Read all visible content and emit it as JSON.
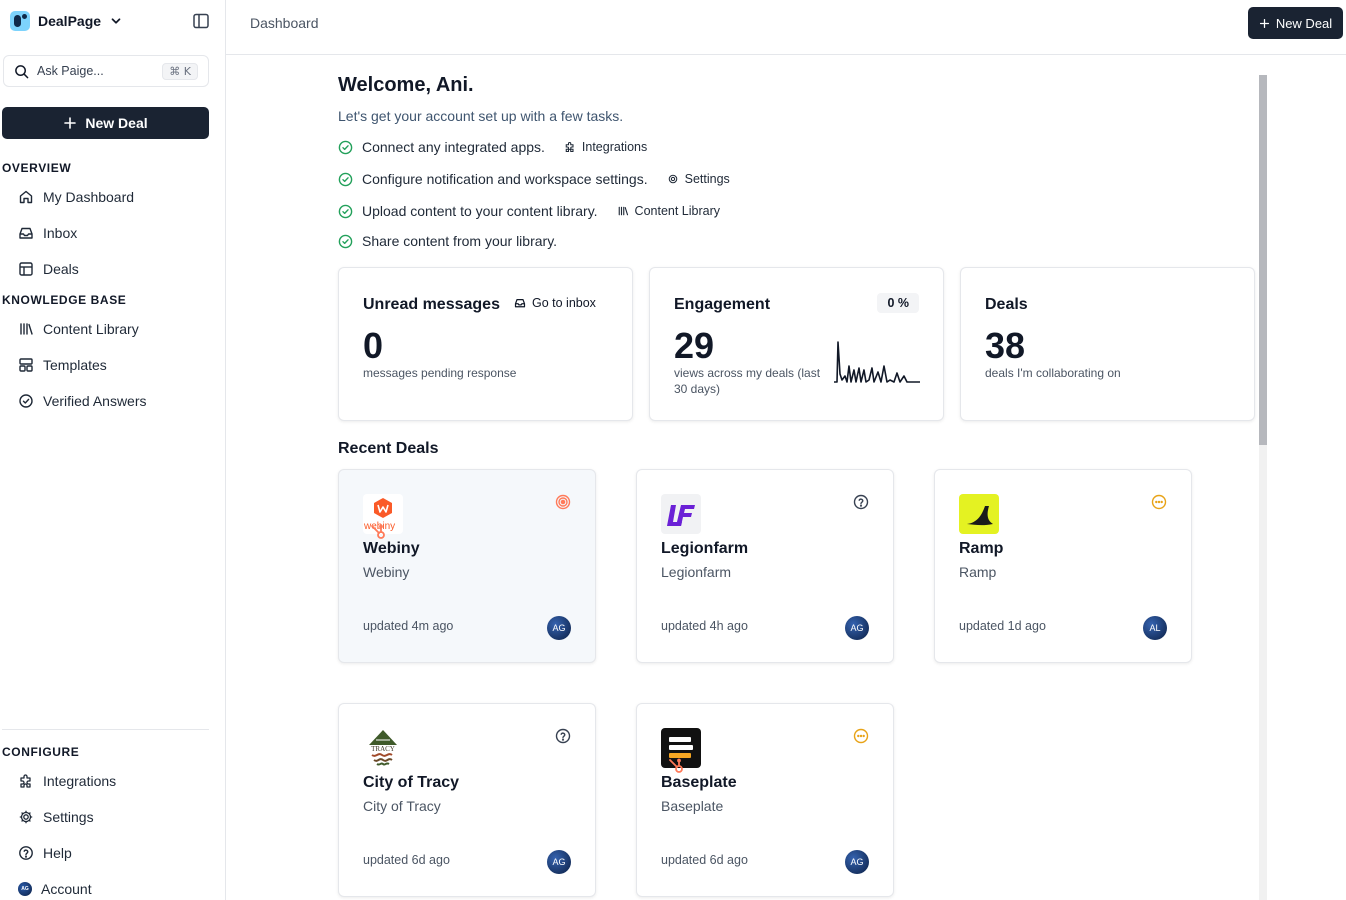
{
  "app": {
    "name": "DealPage"
  },
  "sidebar": {
    "search_placeholder": "Ask Paige...",
    "search_shortcut": "⌘ K",
    "new_deal_label": "New Deal",
    "sections": {
      "overview": "OVERVIEW",
      "knowledge": "KNOWLEDGE BASE",
      "configure": "CONFIGURE"
    },
    "overview_items": [
      "My Dashboard",
      "Inbox",
      "Deals"
    ],
    "knowledge_items": [
      "Content Library",
      "Templates",
      "Verified Answers"
    ],
    "configure_items": [
      "Integrations",
      "Settings",
      "Help",
      "Account"
    ],
    "account_initials": "AG"
  },
  "header": {
    "breadcrumb": "Dashboard",
    "new_deal_label": "New Deal"
  },
  "welcome": {
    "title": "Welcome, Ani.",
    "subtitle": "Let's get your account set up with a few tasks.",
    "tasks": [
      {
        "text": "Connect any integrated apps.",
        "link": "Integrations"
      },
      {
        "text": "Configure notification and workspace settings.",
        "link": "Settings"
      },
      {
        "text": "Upload content to your content library.",
        "link": "Content Library"
      },
      {
        "text": "Share content from your library.",
        "link": ""
      }
    ]
  },
  "stats": {
    "unread": {
      "title": "Unread messages",
      "value": "0",
      "sub": "messages pending response",
      "action": "Go to inbox"
    },
    "engagement": {
      "title": "Engagement",
      "value": "29",
      "sub": "views across my deals (last 30 days)",
      "badge": "0 %"
    },
    "deals": {
      "title": "Deals",
      "value": "38",
      "sub": "deals I'm collaborating on"
    }
  },
  "recent_deals": {
    "title": "Recent Deals",
    "items": [
      {
        "name": "Webiny",
        "company": "Webiny",
        "updated": "updated 4m ago",
        "owner": "AG",
        "status": "target"
      },
      {
        "name": "Legionfarm",
        "company": "Legionfarm",
        "updated": "updated 4h ago",
        "owner": "AG",
        "status": "question"
      },
      {
        "name": "Ramp",
        "company": "Ramp",
        "updated": "updated 1d ago",
        "owner": "AL",
        "status": "pending"
      },
      {
        "name": "City of Tracy",
        "company": "City of Tracy",
        "updated": "updated 6d ago",
        "owner": "AG",
        "status": "question"
      },
      {
        "name": "Baseplate",
        "company": "Baseplate",
        "updated": "updated 6d ago",
        "owner": "AG",
        "status": "pending"
      }
    ]
  },
  "logo_text": {
    "webiny": "webiny",
    "tracy": "TRACY"
  },
  "colors": {
    "primary": "#1a2332",
    "success": "#22a05a",
    "hubspot": "#ff7a59",
    "pending": "#e8a317",
    "webiny": "#fa5a28",
    "legionfarm": "#6b21d6",
    "ramp": "#e4f222"
  }
}
